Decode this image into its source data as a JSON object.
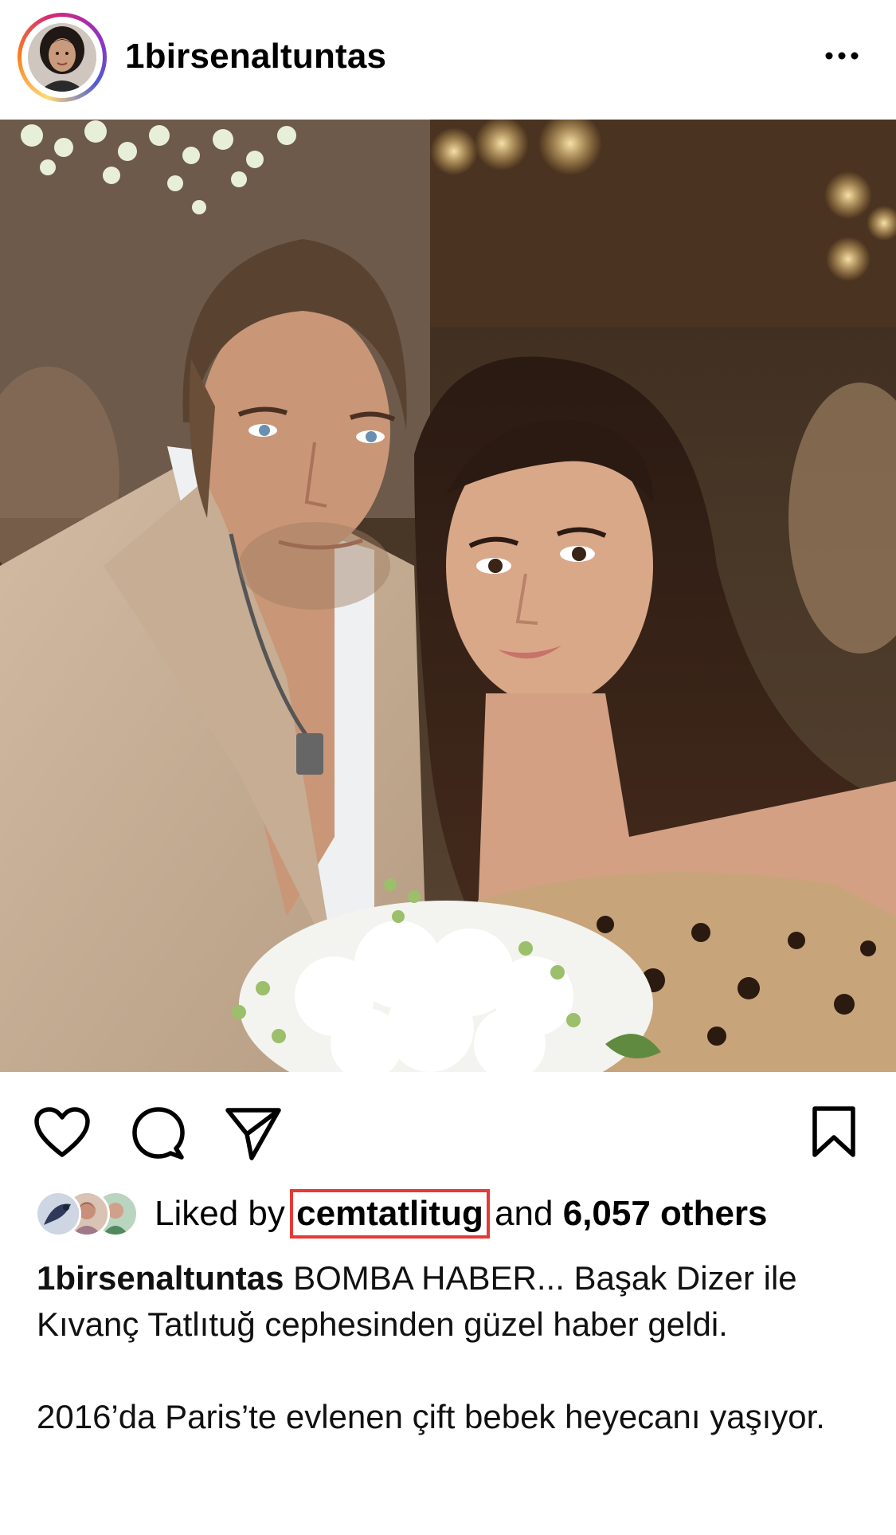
{
  "post": {
    "username": "1birsenaltuntas",
    "more_icon": "more-horizontal-icon"
  },
  "actions": {
    "like_icon": "heart-icon",
    "comment_icon": "comment-icon",
    "share_icon": "send-icon",
    "save_icon": "bookmark-icon"
  },
  "likes": {
    "prefix": "Liked by",
    "liker_username": "cemtatlitug",
    "middle": "and",
    "count_text": "6,057 others"
  },
  "caption": {
    "username": "1birsenaltuntas",
    "text_line1": "BOMBA HABER... Başak Dizer ile Kıvanç Tatlıtuğ cephesinden güzel haber geldi.",
    "text_line2": "2016’da Paris’te evlenen çift bebek heyecanı yaşıyor."
  },
  "colors": {
    "highlight_box": "#e53935",
    "story_ring_start": "#feda75",
    "story_ring_end": "#d62976"
  }
}
